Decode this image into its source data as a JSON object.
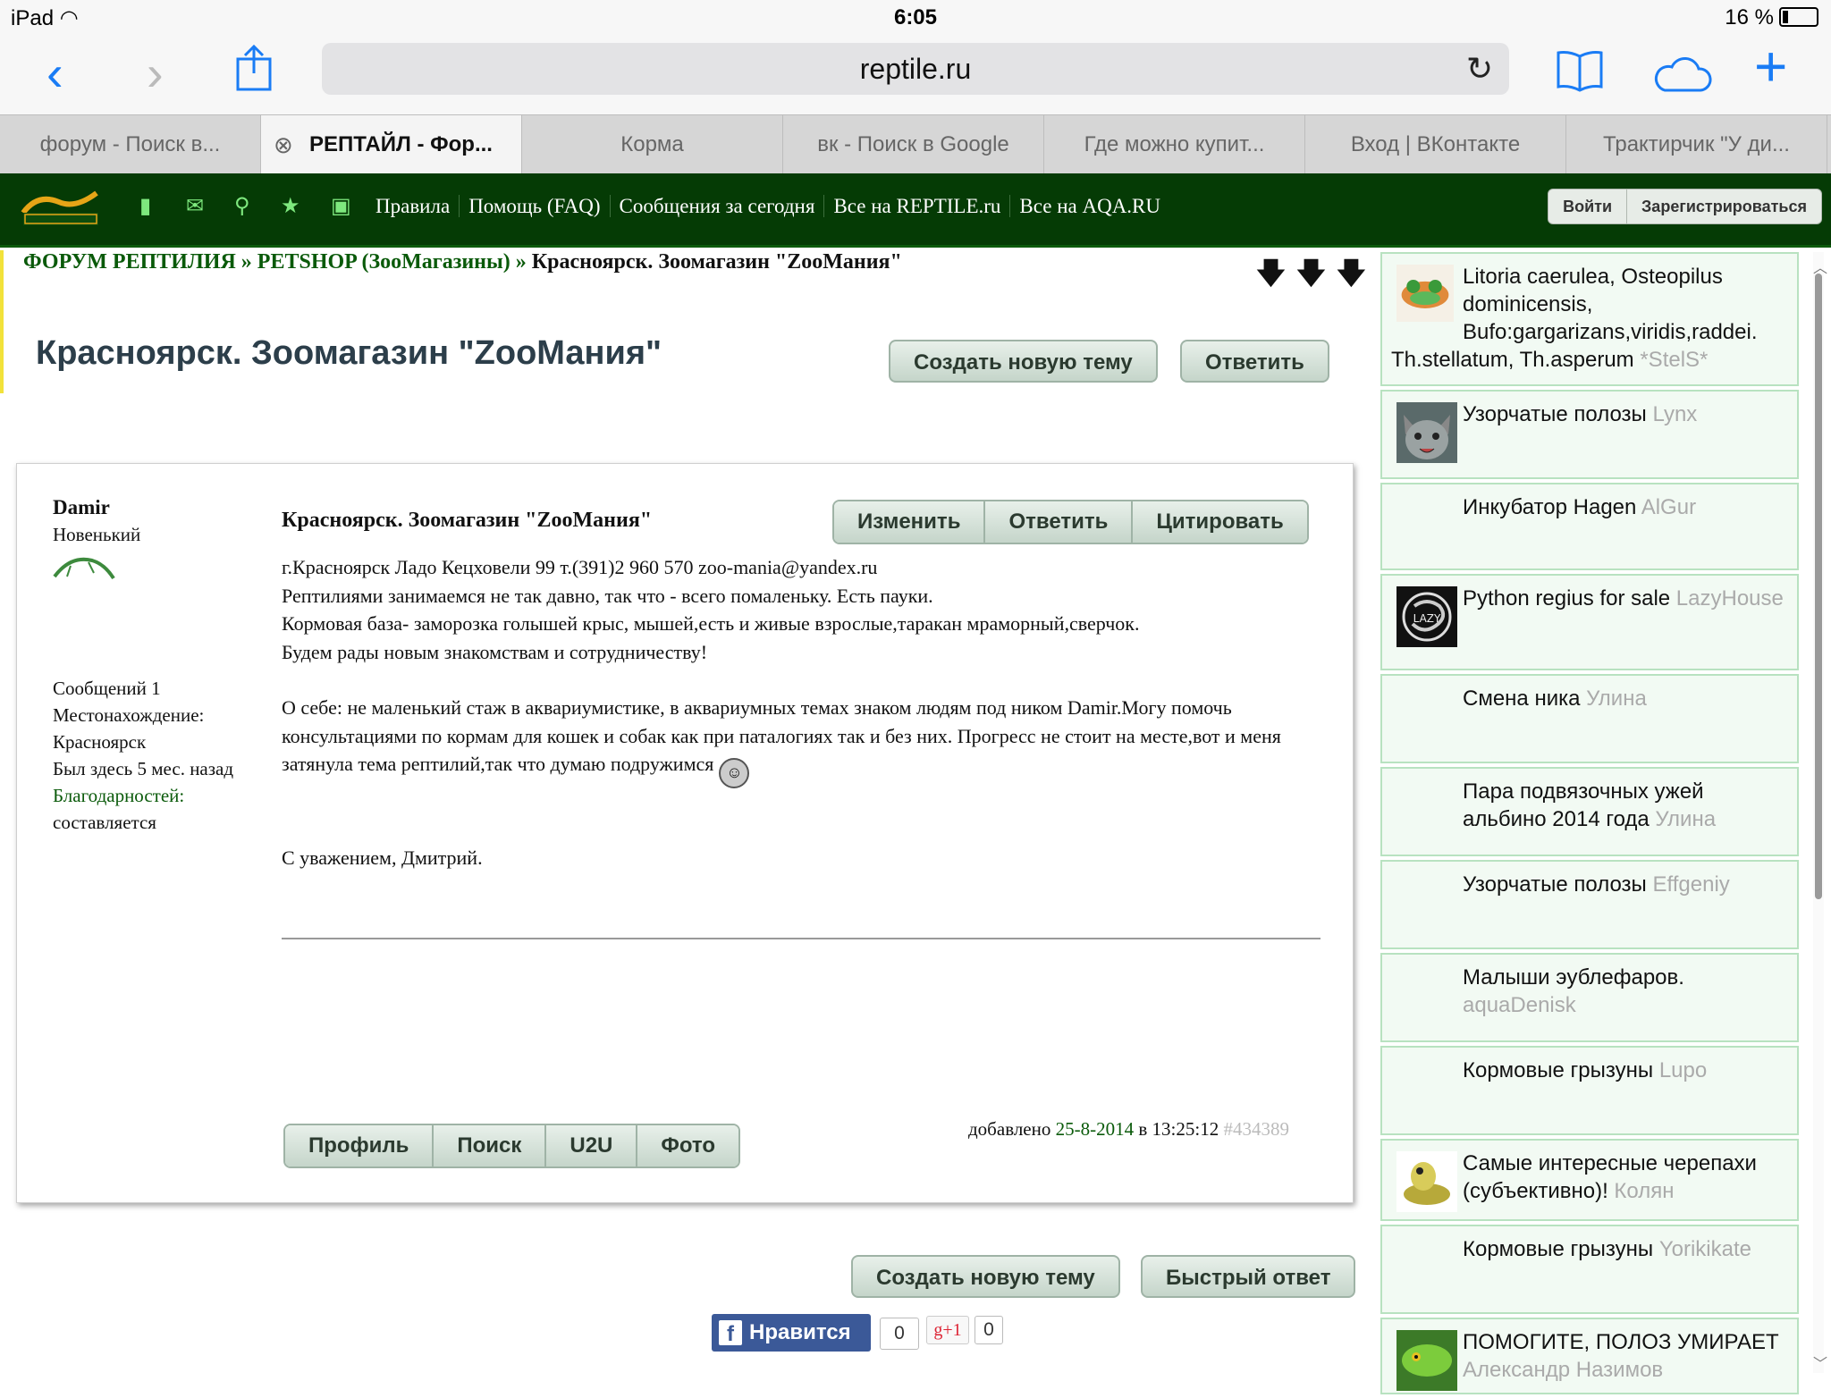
{
  "status": {
    "device": "iPad",
    "time": "6:05",
    "battery": "16 %"
  },
  "browser": {
    "url": "reptile.ru",
    "tabs": [
      {
        "label": "форум - Поиск в..."
      },
      {
        "label": "РЕПТАЙЛ - Фор..."
      },
      {
        "label": "Корма"
      },
      {
        "label": "вк - Поиск в Google"
      },
      {
        "label": "Где можно купит..."
      },
      {
        "label": "Вход | ВКонтакте"
      },
      {
        "label": "Трактирчик \"У ди..."
      }
    ]
  },
  "nav": {
    "links": [
      "Правила",
      "Помощь (FAQ)",
      "Сообщения за сегодня",
      "Все на REPTILE.ru",
      "Все на AQA.RU"
    ],
    "login": "Войти",
    "register": "Зарегистрироваться"
  },
  "breadcrumb": {
    "forum": "ФОРУМ РЕПТИЛИЯ",
    "sep": " » ",
    "section": "PETSHOP (ЗооМагазины)",
    "current": "Красноярск. Зоомагазин \"ZooМания\""
  },
  "page": {
    "title": "Красноярск. Зоомагазин \"ZooМания\"",
    "new_topic": "Создать новую тему",
    "reply": "Ответить",
    "quick_reply": "Быстрый ответ"
  },
  "post": {
    "author": {
      "name": "Damir",
      "rank": "Новенький",
      "messages": "Сообщений 1",
      "location_label": "Местонахождение:",
      "location": "Красноярск",
      "last_seen": "Был здесь 5 мес. назад",
      "thanks_label": "Благодарностей:",
      "thanks_value": "составляется"
    },
    "title": "Красноярск. Зоомагазин \"ZooМания\"",
    "actions": [
      "Изменить",
      "Ответить",
      "Цитировать"
    ],
    "lines": [
      "г.Красноярск Ладо Кецховели 99 т.(391)2 960 570 zoo-mania@yandex.ru",
      "Рептилиями занимаемся не так давно, так что - всего помаленьку. Есть пауки.",
      "Кормовая база- заморозка голышей крыс, мышей,есть и живые взрослые,таракан мраморный,сверчок.",
      "Будем рады новым знакомствам и сотрудничеству!"
    ],
    "about": "О себе: не маленький стаж в аквариумистике, в аквариумных темах знаком людям под ником Damir.Могу помочь консультациями по кормам для кошек и собак как при паталогиях так и без них. Прогресс не стоит на месте,вот и меня затянула тема рептилий,так что думаю подружимся",
    "signoff": "С уважением, Дмитрий.",
    "user_buttons": [
      "Профиль",
      "Поиск",
      "U2U",
      "Фото"
    ],
    "added_label": "добавлено",
    "added_date": "25-8-2014",
    "added_at": "в 13:25:12",
    "post_id": "#434389"
  },
  "social": {
    "fb_label": "Нравится",
    "fb_count": "0",
    "gplus_label": "g+1",
    "gplus_count": "0"
  },
  "sidebar": [
    {
      "title": "Litoria caerulea, Osteopilus dominicensis, Bufo:gargarizans,viridis,raddei. Th.stellatum, Th.asperum",
      "user": "*StelS*",
      "avatar": "frog"
    },
    {
      "title": "Узорчатые полозы",
      "user": "Lynx",
      "avatar": "cat"
    },
    {
      "title": "Инкубатор Hagen",
      "user": "AlGur",
      "avatar": ""
    },
    {
      "title": "Python regius for sale",
      "user": "LazyHouse",
      "avatar": "lazyhouse"
    },
    {
      "title": "Смена ника",
      "user": "Улина",
      "avatar": ""
    },
    {
      "title": "Пара подвязочных ужей альбино 2014 года",
      "user": "Улина",
      "avatar": ""
    },
    {
      "title": "Узорчатые полозы",
      "user": "Effgeniy",
      "avatar": ""
    },
    {
      "title": "Малыши эублефаров.",
      "user": "aquaDenisk",
      "avatar": ""
    },
    {
      "title": "Кормовые грызуны",
      "user": "Lupo",
      "avatar": ""
    },
    {
      "title": "Самые интересные черепахи (субъективно)!",
      "user": "Колян",
      "avatar": "turtle"
    },
    {
      "title": "Кормовые грызуны",
      "user": "Yorikikate",
      "avatar": ""
    },
    {
      "title": "ПОМОГИТЕ, ПОЛОЗ УМИРАЕТ",
      "user": "Александр Назимов",
      "avatar": "snake"
    }
  ],
  "colors": {
    "site_green": "#053b05",
    "link_green": "#0a5a0a",
    "ios_blue": "#1a7cf5",
    "sidebar_border": "#b8e2c0"
  }
}
